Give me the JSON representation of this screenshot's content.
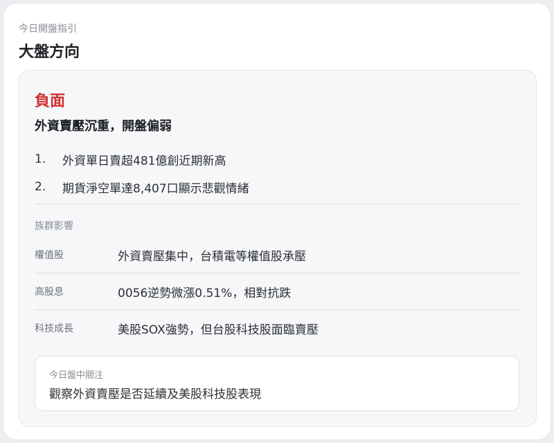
{
  "header": {
    "eyebrow": "今日開盤指引",
    "title": "大盤方向"
  },
  "outlook": {
    "sentiment": "負面",
    "sentiment_color": "#d32f2f",
    "headline": "外資賣壓沉重，開盤偏弱",
    "points": [
      {
        "num": "1.",
        "text": "外資單日賣超481億創近期新高"
      },
      {
        "num": "2.",
        "text": "期貨淨空單達8,407口顯示悲觀情緒"
      }
    ]
  },
  "sector_impact": {
    "label": "族群影響",
    "rows": [
      {
        "name": "權值股",
        "note": "外資賣壓集中，台積電等權值股承壓"
      },
      {
        "name": "高股息",
        "note": "0056逆勢微漲0.51%，相對抗跌"
      },
      {
        "name": "科技成長",
        "note": "美股SOX強勢，但台股科技股面臨賣壓"
      }
    ]
  },
  "watch": {
    "label": "今日盤中關注",
    "text": "觀察外資賣壓是否延續及美股科技股表現"
  }
}
